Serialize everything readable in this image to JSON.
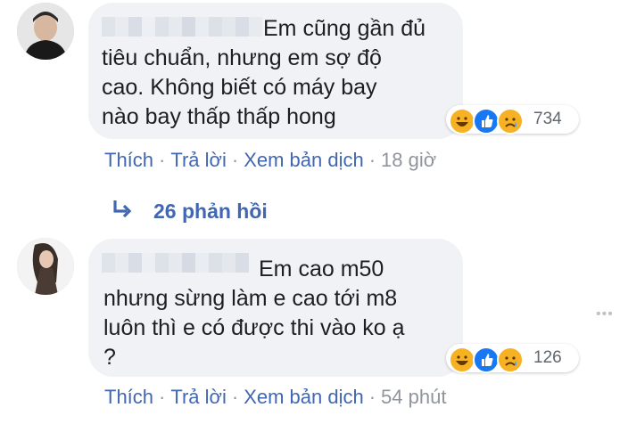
{
  "comments": [
    {
      "text": "tiêu chuẩn, nhưng em sợ độ\ncao. Không biết có máy bay\nnào bay thấp thấp hong",
      "first_line": "Em cũng gần đủ",
      "reaction_count": "734",
      "actions": {
        "like": "Thích",
        "reply": "Trả lời",
        "translate": "Xem bản dịch",
        "time": "18 giờ"
      }
    },
    {
      "text": "nhưng sừng làm e cao tới m8\nluôn thì e có được thi vào ko ạ\n?",
      "first_line": "Em cao m50",
      "reaction_count": "126",
      "actions": {
        "like": "Thích",
        "reply": "Trả lời",
        "translate": "Xem bản dịch",
        "time": "54 phút"
      }
    }
  ],
  "replies_link": {
    "label": "26 phản hồi",
    "icon": "reply-arrow-icon"
  },
  "reactions_icons": [
    "haha-icon",
    "like-icon",
    "sad-icon"
  ],
  "colors": {
    "link": "#4267b2",
    "bubble": "#f1f2f5",
    "meta": "#90949c",
    "haha": "#f7b125",
    "like": "#1877f2"
  },
  "dot_separator": "·",
  "more_icon": "•••"
}
